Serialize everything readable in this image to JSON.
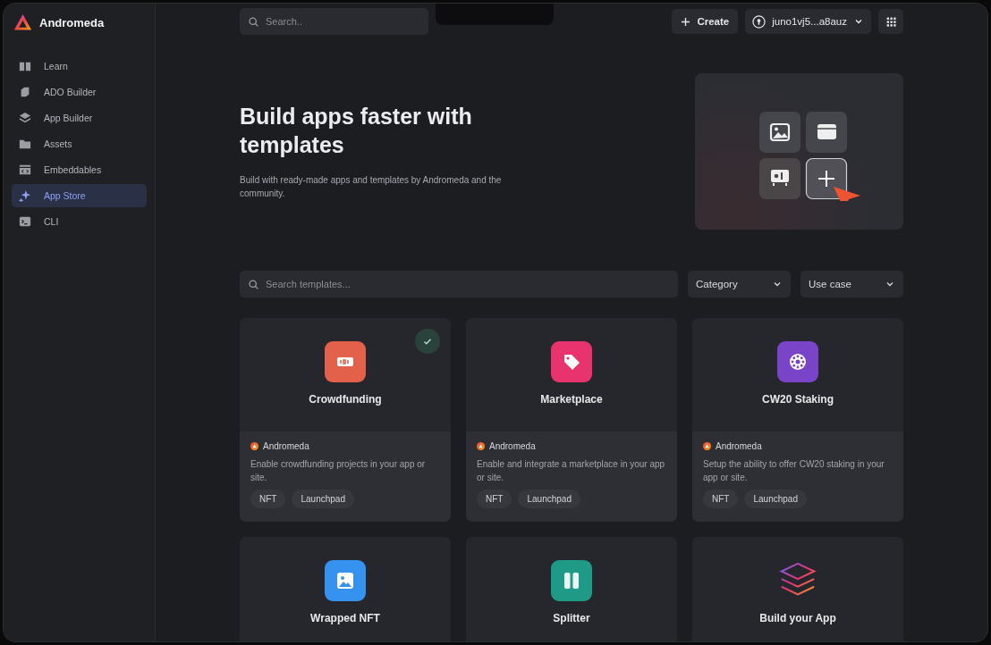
{
  "sidebar": {
    "brand": "Andromeda",
    "items": [
      {
        "label": "Learn",
        "kind": "book",
        "selected": false
      },
      {
        "label": "ADO Builder",
        "kind": "cube",
        "selected": false
      },
      {
        "label": "App Builder",
        "kind": "layers",
        "selected": false
      },
      {
        "label": "Assets",
        "kind": "folder",
        "selected": false
      },
      {
        "label": "Embeddables",
        "kind": "embed",
        "selected": false
      },
      {
        "label": "App Store",
        "kind": "sparkle",
        "selected": true
      },
      {
        "label": "CLI",
        "kind": "terminal",
        "selected": false
      }
    ]
  },
  "topbar": {
    "search_placeholder": "Search..",
    "create_button": "Create",
    "wallet": "juno1vj5...a8auz"
  },
  "hero": {
    "title": "Build apps faster with templates",
    "subtitle": "Build with ready-made apps and templates by Andromeda and the community."
  },
  "filters": {
    "search_placeholder": "Search templates...",
    "dropdowns": [
      "Category",
      "Use case"
    ]
  },
  "templates": [
    {
      "name": "Crowdfunding",
      "kind": "ticket",
      "color": "#e3604b",
      "checked": true,
      "publisher": "Andromeda",
      "description": "Enable crowdfunding projects in your app or site.",
      "tags": [
        "NFT",
        "Launchpad"
      ]
    },
    {
      "name": "Marketplace",
      "kind": "tag",
      "color": "#e8336f",
      "checked": false,
      "publisher": "Andromeda",
      "description": "Enable and integrate a marketplace in your app or site.",
      "tags": [
        "NFT",
        "Launchpad"
      ]
    },
    {
      "name": "CW20 Staking",
      "kind": "wheel",
      "color": "#7a44c9",
      "checked": false,
      "publisher": "Andromeda",
      "description": "Setup the ability to offer CW20 staking in your app or site.",
      "tags": [
        "NFT",
        "Launchpad"
      ]
    },
    {
      "name": "Wrapped NFT",
      "kind": "image",
      "color": "#3592ee",
      "checked": false
    },
    {
      "name": "Splitter",
      "kind": "pause",
      "color": "#1f9a86",
      "checked": false
    },
    {
      "name": "Build your App",
      "kind": "stack",
      "checked": false
    }
  ]
}
